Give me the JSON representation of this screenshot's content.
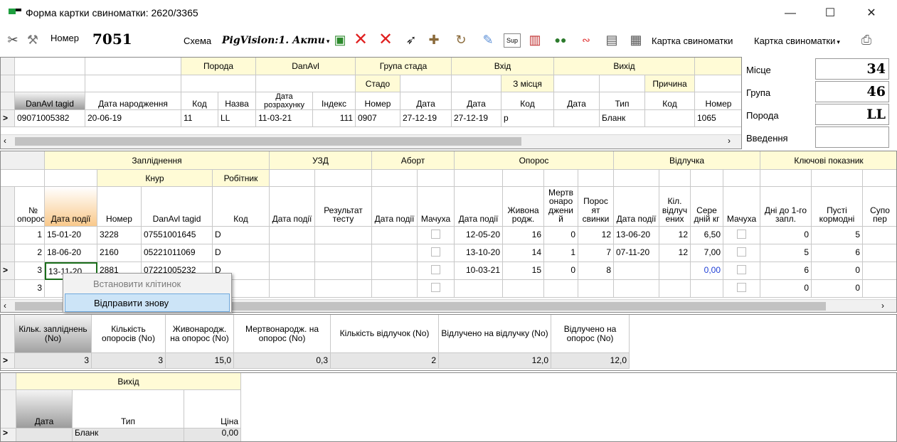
{
  "window": {
    "title": "Форма картки свиноматки: 2620/3365",
    "minimize": "—",
    "maximize": "☐",
    "close": "✕"
  },
  "toolbar": {
    "number_label": "Номер",
    "number_value": "7051",
    "scheme_label": "Схема",
    "scheme_value": "PigVision:1. Акти",
    "card_label": "Картка свиноматки",
    "card_combo": "Картка свиноматки"
  },
  "side": {
    "place_label": "Місце",
    "place_value": "34",
    "group_label": "Група",
    "group_value": "46",
    "breed_label": "Порода",
    "breed_value": "LL",
    "intro_label": "Введення",
    "intro_value": ""
  },
  "grid1": {
    "bands": {
      "breed": "Порода",
      "danavl": "DanAvl",
      "herd_group": "Група стада",
      "entry": "Вхід",
      "exit": "Вихід"
    },
    "sub": {
      "herd": "Стадо",
      "from_place": "З місця",
      "reason": "Причина"
    },
    "headers": [
      "DanAvl tagid",
      "Дата народження",
      "Код",
      "Назва",
      "Дата розрахунку",
      "Індекс",
      "Номер",
      "Дата",
      "Дата",
      "Код",
      "Дата",
      "Тип",
      "Код",
      "Номер"
    ],
    "row": [
      "09071005382",
      "20-06-19",
      "11",
      "LL",
      "11-03-21",
      "111",
      "0907",
      "27-12-19",
      "27-12-19",
      "р",
      "",
      "Бланк",
      "",
      "1065"
    ]
  },
  "grid2": {
    "bands": {
      "insem": "Запліднення",
      "uzd": "УЗД",
      "abort": "Аборт",
      "farrow": "Опорос",
      "wean": "Відлучка",
      "kpi": "Ключові показник"
    },
    "sub": {
      "boar": "Кнур",
      "worker": "Робітник"
    },
    "headers": [
      "№ опоросу",
      "Дата події",
      "Номер",
      "DanAvl tagid",
      "Код",
      "Дата події",
      "Результат тесту",
      "Дата події",
      "Мачуха",
      "Дата події",
      "Живона родж.",
      "Мертв онаро джени й",
      "Порос ят свинки",
      "Дата події",
      "Кіл. відлуч ених",
      "Сере дній кг",
      "Мачуха",
      "Дні до 1-го запл.",
      "Пусті кормодні",
      "Супо пер"
    ],
    "rows": [
      [
        "1",
        "15-01-20",
        "3228",
        "07551001645",
        "D",
        "",
        "",
        "",
        "",
        "12-05-20",
        "16",
        "0",
        "12",
        "13-06-20",
        "12",
        "6,50",
        "",
        "0",
        "5",
        ""
      ],
      [
        "2",
        "18-06-20",
        "2160",
        "05221011069",
        "D",
        "",
        "",
        "",
        "",
        "13-10-20",
        "14",
        "1",
        "7",
        "07-11-20",
        "12",
        "7,00",
        "",
        "5",
        "6",
        ""
      ],
      [
        "3",
        "13-11-20",
        "2881",
        "07221005232",
        "D",
        "",
        "",
        "",
        "",
        "10-03-21",
        "15",
        "0",
        "8",
        "",
        "",
        "0,00",
        "",
        "6",
        "0",
        ""
      ],
      [
        "3",
        "",
        "",
        "",
        "",
        "",
        "",
        "",
        "",
        "",
        "",
        "",
        "",
        "",
        "",
        "",
        "",
        "0",
        "0",
        ""
      ]
    ]
  },
  "context_menu": {
    "item1": "Встановити клітинок",
    "item2": "Відправити знову"
  },
  "summary": {
    "headers": [
      "Кільк. запліднень (No)",
      "Кількість опоросів (No)",
      "Живонародж. на опорос (No)",
      "Мертвонародж. на опорос (No)",
      "Кількість відлучок (No)",
      "Відлучено на відлучку (No)",
      "Відлучено на опорос (No)"
    ],
    "values": [
      "3",
      "3",
      "15,0",
      "0,3",
      "2",
      "12,0",
      "12,0"
    ]
  },
  "exit_grid": {
    "band": "Вихід",
    "headers": [
      "Дата",
      "Тип",
      "Ціна"
    ],
    "row": [
      "",
      "Бланк",
      "0,00"
    ]
  }
}
